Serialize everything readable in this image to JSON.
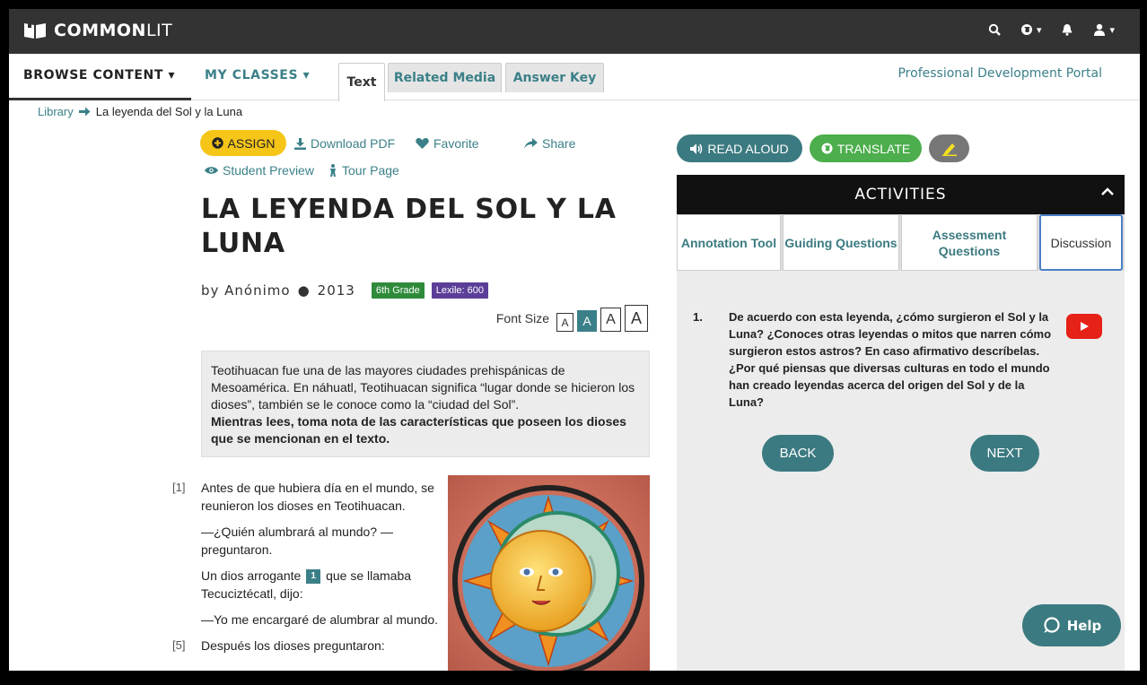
{
  "topbar": {
    "logo_bold": "COMMON",
    "logo_light": "LIT",
    "icons": [
      "search-icon",
      "globe-icon",
      "bell-icon",
      "user-icon"
    ]
  },
  "nav": {
    "browse": "BROWSE CONTENT ▾",
    "classes": "MY CLASSES ▾",
    "tabs": [
      "Text",
      "Related Media",
      "Answer Key"
    ],
    "portal": "Professional Development Portal"
  },
  "breadcrumb": {
    "library": "Library",
    "current": "La leyenda del Sol y la Luna"
  },
  "actions": {
    "assign": "ASSIGN",
    "download": "Download PDF",
    "favorite": "Favorite",
    "share": "Share",
    "preview": "Student Preview",
    "tour": "Tour Page"
  },
  "text": {
    "title": "LA LEYENDA DEL SOL Y LA LUNA",
    "author": "by Anónimo",
    "year": "2013",
    "grade": "6th Grade",
    "lexile": "Lexile: 600",
    "font_size_label": "Font Size",
    "font_size_options": [
      "A",
      "A",
      "A",
      "A"
    ],
    "intro_1": "Teotihuacan fue una de las mayores ciudades prehispánicas de Mesoamérica. En náhuatl, Teotihuacan significa “lugar donde se hicieron los dioses”, también se le conoce como la “ciudad del Sol”.",
    "intro_2": "Mientras lees, toma nota de las características que poseen los dioses que se mencionan en el texto.",
    "p1_num": "[1]",
    "p1": "Antes de que hubiera día en el mundo, se reunieron los dioses en Teotihuacan.",
    "p2": "—¿Quién alumbrará al mundo? —preguntaron.",
    "p3_a": "Un dios arrogante",
    "p3_note": "1",
    "p3_b": "que se llamaba Tecuciztécatl, dijo:",
    "p4": "—Yo me encargaré de alumbrar al mundo.",
    "p5_num": "[5]",
    "p5": "Después los dioses preguntaron:"
  },
  "panel": {
    "read_aloud": "READ ALOUD",
    "translate": "TRANSLATE",
    "activities": "ACTIVITIES",
    "tabs": [
      {
        "label": "Annotation Tool"
      },
      {
        "label": "Guiding Questions"
      },
      {
        "label": "Assessment Questions"
      },
      {
        "label": "Discussion"
      }
    ],
    "question_num": "1.",
    "question": "De acuerdo con esta leyenda, ¿cómo surgieron el Sol y la Luna? ¿Conoces otras leyendas o mitos que narren cómo surgieron estos astros? En caso afirmativo descríbelas. ¿Por qué piensas que diversas culturas en todo el mundo han creado leyendas acerca del origen del Sol y de la Luna?",
    "back": "BACK",
    "next": "NEXT"
  },
  "help": "Help",
  "colors": {
    "teal": "#3b8088",
    "assign_yellow": "#f5c518",
    "translate_green": "#4cae4c",
    "grade_green": "#2e8b3a",
    "lexile_purple": "#5b3e98",
    "youtube_red": "#e62117"
  }
}
